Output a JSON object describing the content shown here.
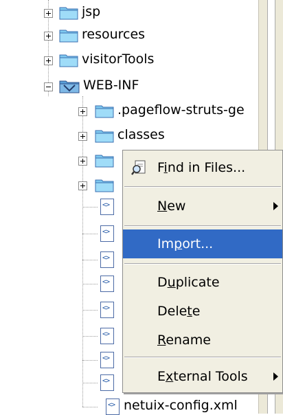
{
  "tree": {
    "folders": [
      {
        "label": "jsp",
        "expander": "plus"
      },
      {
        "label": "resources",
        "expander": "plus"
      },
      {
        "label": "visitorTools",
        "expander": "plus"
      },
      {
        "label": "WEB-INF",
        "expander": "minus"
      },
      {
        "label": ".pageflow-struts-ge",
        "expander": "plus"
      },
      {
        "label": "classes",
        "expander": "plus"
      }
    ],
    "last_file": "netuix-config.xml"
  },
  "context_menu": {
    "items": [
      {
        "label_parts": [
          "F",
          "i",
          "nd in Files..."
        ],
        "icon": "find-in-files-icon"
      },
      {
        "label_parts": [
          "",
          "N",
          "ew"
        ],
        "submenu": true
      },
      {
        "label_parts": [
          "Im",
          "p",
          "ort..."
        ],
        "highlighted": true
      },
      {
        "label_parts": [
          "D",
          "u",
          "plicate"
        ]
      },
      {
        "label_parts": [
          "Dele",
          "t",
          "e"
        ]
      },
      {
        "label_parts": [
          "",
          "R",
          "ename"
        ]
      },
      {
        "label_parts": [
          "E",
          "x",
          "ternal Tools"
        ],
        "submenu": true
      }
    ]
  },
  "colors": {
    "highlight": "#316ac5",
    "menu_bg": "#f1efe2",
    "folder": "#6fc3ee"
  }
}
